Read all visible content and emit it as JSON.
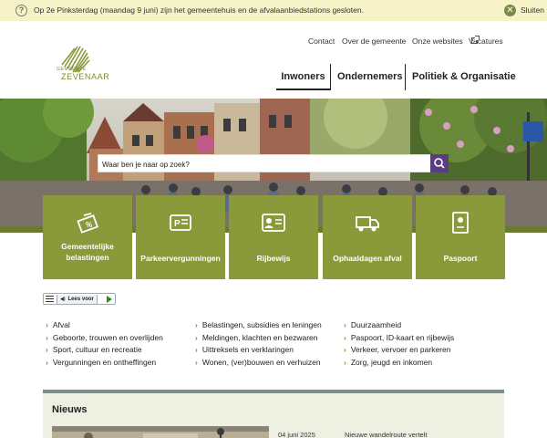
{
  "notice": {
    "message": "Op 2e Pinksterdag (maandag 9 juni) zijn het gemeentehuis en de afvalaanbiedstations gesloten.",
    "close_label": "Sluiten",
    "close_symbol": "✕",
    "info_symbol": "?"
  },
  "logo": {
    "small": "GEMEENTE",
    "name": "ZEVENAAR"
  },
  "toplinks": [
    "Contact",
    "Over de gemeente",
    "Onze websites",
    "Vacatures"
  ],
  "nav": [
    "Inwoners",
    "Ondernemers",
    "Politiek & Organisatie"
  ],
  "search": {
    "placeholder": "Waar ben je naar op zoek?"
  },
  "tiles": [
    {
      "label": "Gemeentelijke belastingen",
      "icon": "tax-icon"
    },
    {
      "label": "Parkeervergunningen",
      "icon": "parking-permit-icon"
    },
    {
      "label": "Rijbewijs",
      "icon": "id-card-icon"
    },
    {
      "label": "Ophaaldagen afval",
      "icon": "truck-icon"
    },
    {
      "label": "Paspoort",
      "icon": "passport-icon"
    }
  ],
  "readaloud": {
    "label": "Lees voor"
  },
  "links": {
    "col1": [
      "Afval",
      "Geboorte, trouwen en overlijden",
      "Sport, cultuur en recreatie",
      "Vergunningen en ontheffingen"
    ],
    "col2": [
      "Belastingen, subsidies en leningen",
      "Meldingen, klachten en bezwaren",
      "Uittreksels en verklaringen",
      "Wonen, (ver)bouwen en verhuizen"
    ],
    "col3": [
      "Duurzaamheid",
      "Paspoort, ID-kaart en rijbewijs",
      "Verkeer, vervoer en parkeren",
      "Zorg, jeugd en inkomen"
    ]
  },
  "news": {
    "title": "Nieuws",
    "date": "04 juni 2025",
    "headline": "Nieuwe wandelroute vertelt"
  },
  "colors": {
    "brand": "#8a9a3a",
    "notice_bg": "#f7f3c9",
    "search_button": "#5a3c83"
  }
}
